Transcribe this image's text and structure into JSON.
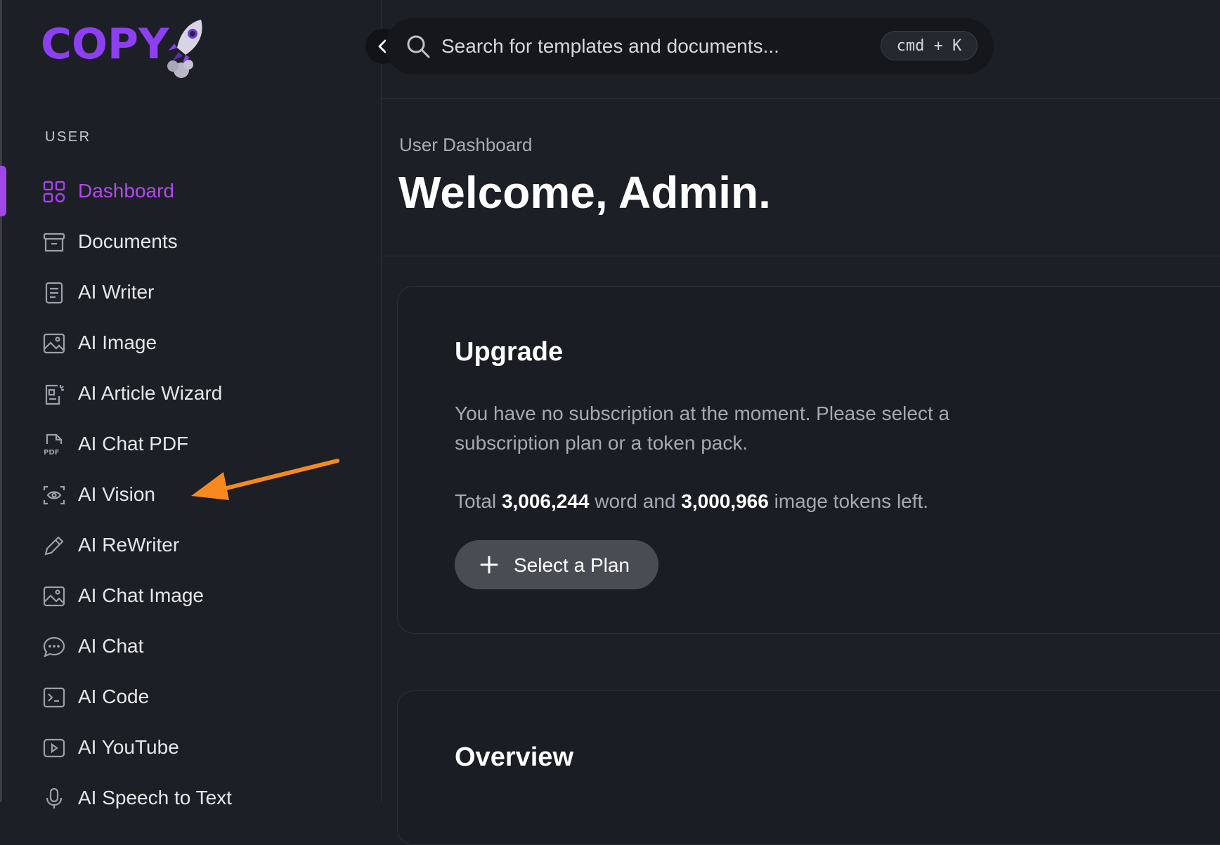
{
  "brand": {
    "logo_text": "COPY",
    "accent": "#8d3ff2",
    "active_color": "#b04ae8"
  },
  "sidebar": {
    "section_label": "USER",
    "items": [
      {
        "label": "Dashboard",
        "icon": "dashboard-grid-icon",
        "active": true
      },
      {
        "label": "Documents",
        "icon": "archive-box-icon"
      },
      {
        "label": "AI Writer",
        "icon": "document-text-icon"
      },
      {
        "label": "AI Image",
        "icon": "image-icon"
      },
      {
        "label": "AI Article Wizard",
        "icon": "article-wizard-icon"
      },
      {
        "label": "AI Chat PDF",
        "icon": "pdf-file-icon"
      },
      {
        "label": "AI Vision",
        "icon": "scan-eye-icon"
      },
      {
        "label": "AI ReWriter",
        "icon": "pencil-icon"
      },
      {
        "label": "AI Chat Image",
        "icon": "image-icon"
      },
      {
        "label": "AI Chat",
        "icon": "chat-bubble-icon"
      },
      {
        "label": "AI Code",
        "icon": "terminal-icon"
      },
      {
        "label": "AI YouTube",
        "icon": "youtube-play-icon"
      },
      {
        "label": "AI Speech to Text",
        "icon": "microphone-icon"
      }
    ]
  },
  "search": {
    "placeholder": "Search for templates and documents...",
    "shortcut": "cmd + K"
  },
  "header": {
    "breadcrumb": "User Dashboard",
    "title": "Welcome, Admin."
  },
  "upgrade_card": {
    "title": "Upgrade",
    "message": "You have no subscription at the moment. Please select a subscription plan or a token pack.",
    "tokens_prefix": "Total",
    "word_tokens": "3,006,244",
    "tokens_middle": "word and",
    "image_tokens": "3,000,966",
    "tokens_suffix": "image tokens left.",
    "button_label": "Select a Plan"
  },
  "overview_card": {
    "title": "Overview"
  },
  "annotation": {
    "arrow_color": "#f7891f"
  }
}
